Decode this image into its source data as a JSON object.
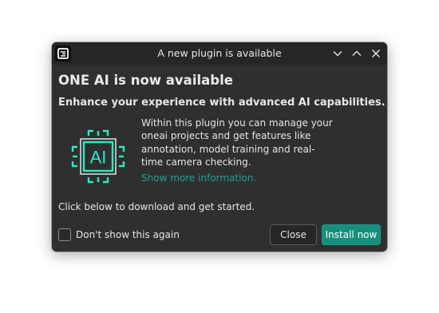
{
  "window": {
    "title": "A new plugin is available"
  },
  "content": {
    "heading": "ONE AI is now available",
    "subheading": "Enhance your experience with advanced AI capabilities.",
    "logo_text": "AI",
    "description": "Within this plugin you can manage your oneai projects and get features like annotation, model training and real-time camera checking.",
    "more_link": "Show more information.",
    "download_text": "Click below to download and get started."
  },
  "footer": {
    "checkbox_label": "Don't show this again",
    "checkbox_checked": false,
    "close_label": "Close",
    "install_label": "Install now"
  },
  "colors": {
    "accent": "#168f7d",
    "link": "#1fa38e",
    "logo_cyan": "#2ee8c4",
    "background": "#2f2f2f",
    "titlebar": "#262626"
  },
  "icons": {
    "app": "app-menu-icon",
    "minimize": "chevron-down-icon",
    "maximize": "chevron-up-icon",
    "close": "close-icon",
    "logo": "ai-chip-icon"
  }
}
